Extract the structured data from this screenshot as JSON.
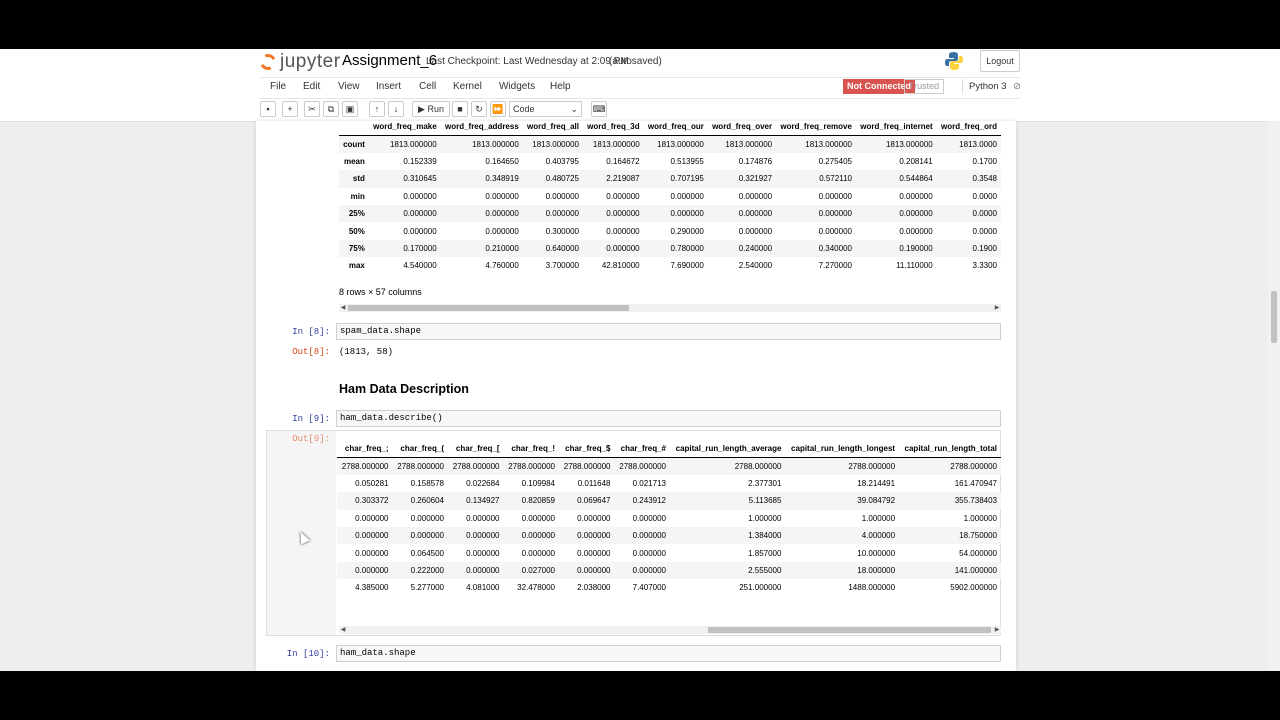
{
  "header": {
    "logo_text": "jupyter",
    "notebook_name": "Assignment_6",
    "checkpoint": "Last Checkpoint: Last Wednesday at 2:09 PM",
    "autosaved": "(autosaved)",
    "logout_label": "Logout",
    "status_not_connected": "Not Connected",
    "status_trusted": "Trusted",
    "kernel_name": "Python 3"
  },
  "menu": [
    "File",
    "Edit",
    "View",
    "Insert",
    "Cell",
    "Kernel",
    "Widgets",
    "Help"
  ],
  "toolbar": {
    "run_label": "Run",
    "cell_type": "Code"
  },
  "spam_describe": {
    "columns": [
      "",
      "word_freq_make",
      "word_freq_address",
      "word_freq_all",
      "word_freq_3d",
      "word_freq_our",
      "word_freq_over",
      "word_freq_remove",
      "word_freq_internet",
      "word_freq_ord"
    ],
    "rows": [
      [
        "count",
        "1813.000000",
        "1813.000000",
        "1813.000000",
        "1813.000000",
        "1813.000000",
        "1813.000000",
        "1813.000000",
        "1813.000000",
        "1813.0000"
      ],
      [
        "mean",
        "0.152339",
        "0.164650",
        "0.403795",
        "0.164672",
        "0.513955",
        "0.174876",
        "0.275405",
        "0.208141",
        "0.1700"
      ],
      [
        "std",
        "0.310645",
        "0.348919",
        "0.480725",
        "2.219087",
        "0.707195",
        "0.321927",
        "0.572110",
        "0.544864",
        "0.3548"
      ],
      [
        "min",
        "0.000000",
        "0.000000",
        "0.000000",
        "0.000000",
        "0.000000",
        "0.000000",
        "0.000000",
        "0.000000",
        "0.0000"
      ],
      [
        "25%",
        "0.000000",
        "0.000000",
        "0.000000",
        "0.000000",
        "0.000000",
        "0.000000",
        "0.000000",
        "0.000000",
        "0.0000"
      ],
      [
        "50%",
        "0.000000",
        "0.000000",
        "0.300000",
        "0.000000",
        "0.290000",
        "0.000000",
        "0.000000",
        "0.000000",
        "0.0000"
      ],
      [
        "75%",
        "0.170000",
        "0.210000",
        "0.640000",
        "0.000000",
        "0.780000",
        "0.240000",
        "0.340000",
        "0.190000",
        "0.1900"
      ],
      [
        "max",
        "4.540000",
        "4.760000",
        "3.700000",
        "42.810000",
        "7.690000",
        "2.540000",
        "7.270000",
        "11.110000",
        "3.3300"
      ]
    ],
    "shape_note": "8 rows × 57 columns"
  },
  "cells": {
    "in8_prompt": "In [8]:",
    "in8_code": "spam_data.shape",
    "out8_prompt": "Out[8]:",
    "out8_text": "(1813, 58)",
    "ham_heading": "Ham Data Description",
    "in9_prompt": "In [9]:",
    "in9_code": "ham_data.describe()",
    "out9_prompt": "Out[9]:",
    "in10_prompt": "In [10]:",
    "in10_code": "ham_data.shape"
  },
  "ham_describe": {
    "columns": [
      "char_freq_;",
      "char_freq_(",
      "char_freq_[",
      "char_freq_!",
      "char_freq_$",
      "char_freq_#",
      "capital_run_length_average",
      "capital_run_length_longest",
      "capital_run_length_total"
    ],
    "rows": [
      [
        "2788.000000",
        "2788.000000",
        "2788.000000",
        "2788.000000",
        "2788.000000",
        "2788.000000",
        "2788.000000",
        "2788.000000",
        "2788.000000"
      ],
      [
        "0.050281",
        "0.158578",
        "0.022684",
        "0.109984",
        "0.011648",
        "0.021713",
        "2.377301",
        "18.214491",
        "161.470947"
      ],
      [
        "0.303372",
        "0.260604",
        "0.134927",
        "0.820859",
        "0.069647",
        "0.243912",
        "5.113685",
        "39.084792",
        "355.738403"
      ],
      [
        "0.000000",
        "0.000000",
        "0.000000",
        "0.000000",
        "0.000000",
        "0.000000",
        "1.000000",
        "1.000000",
        "1.000000"
      ],
      [
        "0.000000",
        "0.000000",
        "0.000000",
        "0.000000",
        "0.000000",
        "0.000000",
        "1.384000",
        "4.000000",
        "18.750000"
      ],
      [
        "0.000000",
        "0.064500",
        "0.000000",
        "0.000000",
        "0.000000",
        "0.000000",
        "1.857000",
        "10.000000",
        "54.000000"
      ],
      [
        "0.000000",
        "0.222000",
        "0.000000",
        "0.027000",
        "0.000000",
        "0.000000",
        "2.555000",
        "18.000000",
        "141.000000"
      ],
      [
        "4.385000",
        "5.277000",
        "4.081000",
        "32.478000",
        "2.038000",
        "7.407000",
        "251.000000",
        "1488.000000",
        "5902.000000"
      ]
    ]
  },
  "colors": {
    "not_connected": "#d9534f",
    "in_prompt": "#303f9f",
    "out_prompt": "#d84315",
    "jupyter_orange": "#f37726"
  }
}
